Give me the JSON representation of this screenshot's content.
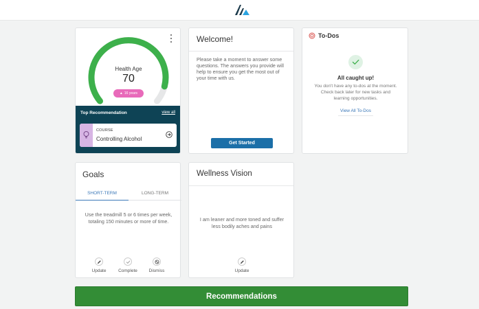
{
  "health_card": {
    "label": "Health Age",
    "value": "70",
    "badge": "16 years",
    "progress_fraction": 0.9,
    "top_recommendation_title": "Top Recommendation",
    "view_all": "view all",
    "course": {
      "tag": "COURSE",
      "name": "Controlling Alcohol"
    }
  },
  "welcome": {
    "title": "Welcome!",
    "text": "Please take a moment to answer some questions. The answers you provide will help to ensure you get the most out of your time with us.",
    "button": "Get Started"
  },
  "todos": {
    "title": "To-Dos",
    "caught_up": "All caught up!",
    "description": "You don't have any to-dos at the moment. Check back later for new tasks and learning opportunities.",
    "link": "View All To-Dos"
  },
  "goals": {
    "title": "Goals",
    "tab_short": "SHORT-TERM",
    "tab_long": "LONG-TERM",
    "text": "Use the treadmill 5 or 6 times per week, totaling 150 minutes or more of time.",
    "actions": {
      "update": "Update",
      "complete": "Complete",
      "dismiss": "Dismiss"
    }
  },
  "vision": {
    "title": "Wellness Vision",
    "text": "I am leaner and more toned and suffer less bodily aches and pains",
    "update": "Update"
  },
  "recommendations_button": "Recommendations",
  "colors": {
    "gauge": "#3db04b",
    "badge": "#e86aba",
    "panel": "#0e4355",
    "button_blue": "#1b6fa8",
    "green_bar": "#338d36",
    "link": "#3b78b8"
  }
}
